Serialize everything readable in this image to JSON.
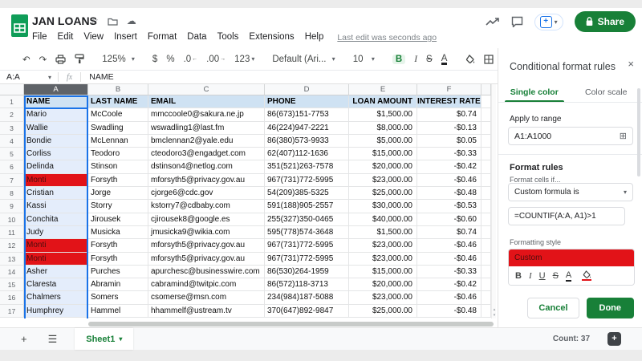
{
  "app": {
    "title": "JAN LOANS",
    "menu": [
      "File",
      "Edit",
      "View",
      "Insert",
      "Format",
      "Data",
      "Tools",
      "Extensions",
      "Help"
    ],
    "last_edit": "Last edit was seconds ago",
    "share_label": "Share"
  },
  "toolbar": {
    "zoom": "125%",
    "currency": "$",
    "percent": "%",
    "decimal_decrease": ".0",
    "decimal_increase": ".00",
    "number_format": "123",
    "font_family": "Default (Ari...",
    "font_size": "10",
    "bold": "B",
    "italic": "I",
    "strikethrough": "S",
    "text_color": "A",
    "more": "..."
  },
  "formula_bar": {
    "name_box": "A:A",
    "fx": "fx",
    "value": "NAME"
  },
  "sheet": {
    "column_letters": [
      "A",
      "B",
      "C",
      "D",
      "E",
      "F"
    ],
    "selected_column": "A",
    "header_row": [
      "NAME",
      "LAST NAME",
      "EMAIL",
      "PHONE",
      "LOAN AMOUNT",
      "INTEREST RATE"
    ],
    "rows": [
      {
        "n": 2,
        "highlight": false,
        "cells": [
          "Mario",
          "McCoole",
          "mmccoole0@sakura.ne.jp",
          "86(673)151-7753",
          "$1,500.00",
          "$0.74"
        ]
      },
      {
        "n": 3,
        "highlight": false,
        "cells": [
          "Wallie",
          "Swadling",
          "wswadling1@last.fm",
          "46(224)947-2221",
          "$8,000.00",
          "-$0.13"
        ]
      },
      {
        "n": 4,
        "highlight": false,
        "cells": [
          "Bondie",
          "McLennan",
          "bmclennan2@yale.edu",
          "86(380)573-9933",
          "$5,000.00",
          "$0.05"
        ]
      },
      {
        "n": 5,
        "highlight": false,
        "cells": [
          "Corliss",
          "Teodoro",
          "cteodoro3@engadget.com",
          "62(407)112-1636",
          "$15,000.00",
          "-$0.33"
        ]
      },
      {
        "n": 6,
        "highlight": false,
        "cells": [
          "Delinda",
          "Stinson",
          "dstinson4@netlog.com",
          "351(521)263-7578",
          "$20,000.00",
          "-$0.42"
        ]
      },
      {
        "n": 7,
        "highlight": true,
        "cells": [
          "Monti",
          "Forsyth",
          "mforsyth5@privacy.gov.au",
          "967(731)772-5995",
          "$23,000.00",
          "-$0.46"
        ]
      },
      {
        "n": 8,
        "highlight": false,
        "cells": [
          "Cristian",
          "Jorge",
          "cjorge6@cdc.gov",
          "54(209)385-5325",
          "$25,000.00",
          "-$0.48"
        ]
      },
      {
        "n": 9,
        "highlight": false,
        "cells": [
          "Kassi",
          "Storry",
          "kstorry7@cdbaby.com",
          "591(188)905-2557",
          "$30,000.00",
          "-$0.53"
        ]
      },
      {
        "n": 10,
        "highlight": false,
        "cells": [
          "Conchita",
          "Jirousek",
          "cjirousek8@google.es",
          "255(327)350-0465",
          "$40,000.00",
          "-$0.60"
        ]
      },
      {
        "n": 11,
        "highlight": false,
        "cells": [
          "Judy",
          "Musicka",
          "jmusicka9@wikia.com",
          "595(778)574-3648",
          "$1,500.00",
          "$0.74"
        ]
      },
      {
        "n": 12,
        "highlight": true,
        "cells": [
          "Monti",
          "Forsyth",
          "mforsyth5@privacy.gov.au",
          "967(731)772-5995",
          "$23,000.00",
          "-$0.46"
        ]
      },
      {
        "n": 13,
        "highlight": true,
        "cells": [
          "Monti",
          "Forsyth",
          "mforsyth5@privacy.gov.au",
          "967(731)772-5995",
          "$23,000.00",
          "-$0.46"
        ]
      },
      {
        "n": 14,
        "highlight": false,
        "cells": [
          "Asher",
          "Purches",
          "apurchesc@businesswire.com",
          "86(530)264-1959",
          "$15,000.00",
          "-$0.33"
        ]
      },
      {
        "n": 15,
        "highlight": false,
        "cells": [
          "Claresta",
          "Abramin",
          "cabramind@twitpic.com",
          "86(572)118-3713",
          "$20,000.00",
          "-$0.42"
        ]
      },
      {
        "n": 16,
        "highlight": false,
        "cells": [
          "Chalmers",
          "Somers",
          "csomerse@msn.com",
          "234(984)187-5088",
          "$23,000.00",
          "-$0.46"
        ]
      },
      {
        "n": 17,
        "highlight": false,
        "cells": [
          "Humphrey",
          "Hammel",
          "hhammelf@ustream.tv",
          "370(647)892-9847",
          "$25,000.00",
          "-$0.48"
        ]
      }
    ],
    "colors": {
      "highlight_red": "#e21318",
      "highlight_text": "#4d0d0d",
      "header_row_fill": "#cfe2f3",
      "selection_blue": "#1a73e8",
      "selection_fill": "#e4edfb",
      "accent_green": "#188038"
    }
  },
  "panel": {
    "title": "Conditional format rules",
    "tabs": [
      {
        "label": "Single color",
        "active": true
      },
      {
        "label": "Color scale",
        "active": false
      }
    ],
    "apply_to_range": {
      "label": "Apply to range",
      "value": "A1:A1000"
    },
    "format_rules": {
      "heading": "Format rules",
      "format_cells_if_label": "Format cells if...",
      "condition": "Custom formula is",
      "formula": "=COUNTIF(A:A, A1)>1"
    },
    "formatting_style": {
      "label": "Formatting style",
      "preview": "Custom"
    },
    "buttons": {
      "cancel": "Cancel",
      "done": "Done"
    }
  },
  "bottom": {
    "sheet_tab": "Sheet1",
    "count": "Count: 37"
  }
}
